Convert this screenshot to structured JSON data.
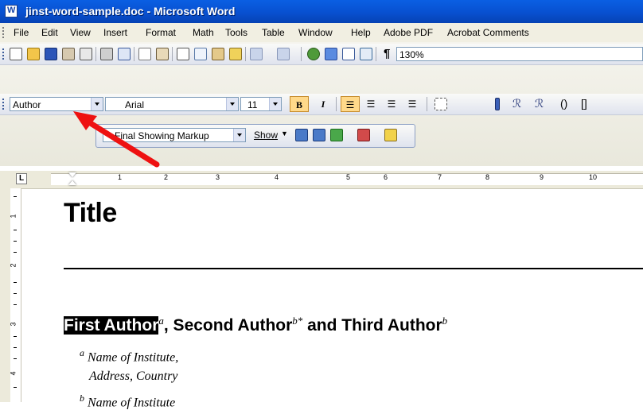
{
  "window": {
    "title": "jinst-word-sample.doc - Microsoft Word"
  },
  "menu": [
    "File",
    "Edit",
    "View",
    "Insert",
    "Format",
    "Math",
    "Tools",
    "Table",
    "Window",
    "Help",
    "Adobe PDF",
    "Acrobat Comments"
  ],
  "formatting": {
    "style_value": "Author",
    "font_value": "Arial",
    "size_value": "11"
  },
  "standard": {
    "zoom_value": "130%"
  },
  "reviewing": {
    "display_value": "Final Showing Markup",
    "show_label": "Show"
  },
  "ruler": {
    "h_numbers": [
      "1",
      "2",
      "3",
      "4",
      "5",
      "6",
      "7",
      "8",
      "9",
      "10"
    ],
    "v_numbers": [
      "1",
      "2",
      "3",
      "4"
    ]
  },
  "document": {
    "title": "Title",
    "first_author": "First Author",
    "first_sup": "a",
    "rest_author_text": ", Second Author",
    "second_sup": "b*",
    "and_text": " and Third Author",
    "third_sup": "b",
    "aff_a_sup": "a",
    "aff_a_line1": "Name of Institute,",
    "aff_a_line2": "Address, Country",
    "aff_b_sup": "b",
    "aff_b_line1": "Name of Institute"
  },
  "colors": {
    "titlebar": "#0a5fe3",
    "arrow": "#ee1111",
    "toolbar": "#e9e8dc"
  }
}
